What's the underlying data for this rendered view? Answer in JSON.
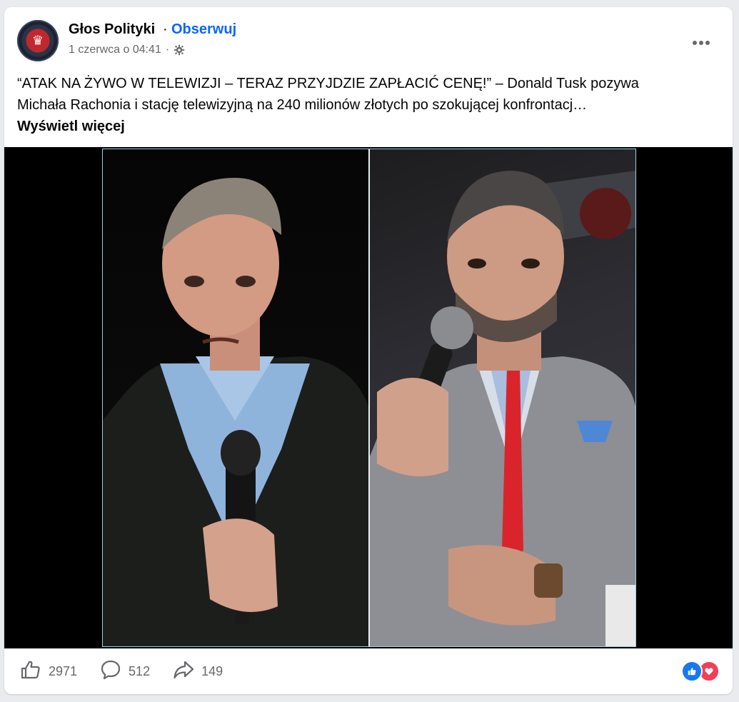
{
  "post": {
    "page_name": "Głos Polityki",
    "separator": "·",
    "follow_label": "Obserwuj",
    "timestamp": "1 czerwca o 04:41",
    "timestamp_separator": "·",
    "text_line1": "“ATAK NA ŻYWO W TELEWIZJI – TERAZ PRZYJDZIE ZAPŁACIĆ CENĘ!” – Donald Tusk pozywa",
    "text_line2": "Michała Rachonia i stację telewizyjną na 240 milionów złotych po szokującej konfrontacj…",
    "see_more_label": "Wyświetl więcej"
  },
  "icons": {
    "avatar": "page-logo-eagle",
    "audience": "gear-icon",
    "more": "more-dots-icon",
    "like": "thumbs-up-icon",
    "comment": "comment-bubble-icon",
    "share": "share-arrow-icon",
    "reaction_like": "like-reaction-icon",
    "reaction_love": "love-reaction-icon"
  },
  "stats": {
    "likes": "2971",
    "comments": "512",
    "shares": "149"
  },
  "colors": {
    "accent": "#0866ff",
    "secondary_text": "#65676b",
    "like_reaction": "#1877f2",
    "love_reaction": "#f33e58"
  }
}
